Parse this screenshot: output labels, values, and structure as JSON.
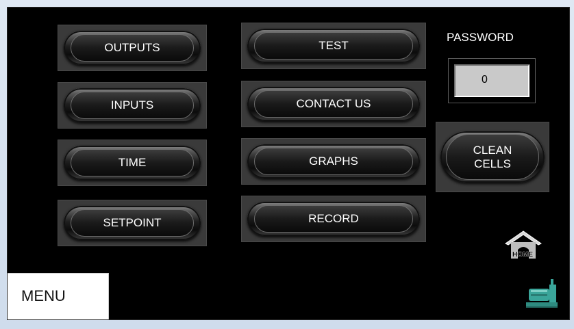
{
  "buttons": {
    "outputs": "OUTPUTS",
    "inputs": "INPUTS",
    "time": "TIME",
    "setpoint": "SETPOINT",
    "test": "TEST",
    "contact_us": "CONTACT US",
    "graphs": "GRAPHS",
    "record": "RECORD",
    "clean_cells": "CLEAN\nCELLS"
  },
  "password": {
    "label": "PASSWORD",
    "value": "0"
  },
  "home": {
    "label": "HOME"
  },
  "menu": {
    "label": "MENU"
  },
  "icons": {
    "home": "home-icon",
    "machine": "pump-machine-icon"
  },
  "colors": {
    "background": "#000000",
    "panel": "#3a3a3a",
    "field": "#c9c9c9",
    "machine": "#3aa59a"
  }
}
